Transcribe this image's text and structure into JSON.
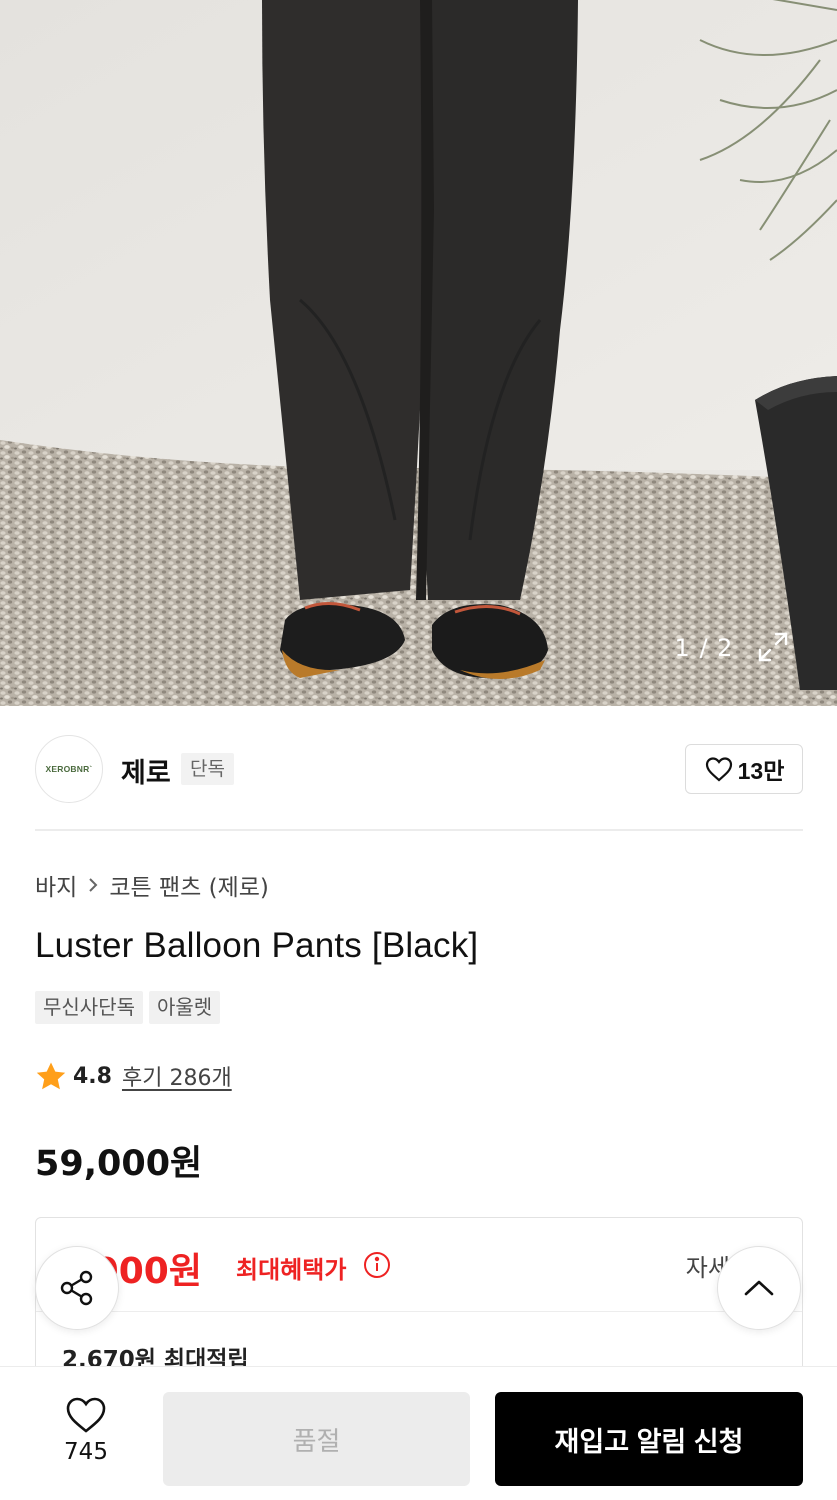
{
  "gallery": {
    "counter": "1 / 2",
    "expand_icon": "expand-icon"
  },
  "brand": {
    "logo_text": "XEROBNR`",
    "name": "제로",
    "badge": "단독",
    "like_count": "13만"
  },
  "breadcrumb": {
    "category": "바지",
    "subcategory": "코튼 팬츠 (제로)"
  },
  "product": {
    "title": "Luster Balloon Pants [Black]",
    "tags": [
      "무신사단독",
      "아울렛"
    ],
    "rating": "4.8",
    "reviews": "후기 286개",
    "price": "59,000원"
  },
  "benefit": {
    "price_partial": ",000원",
    "label": "최대혜택가",
    "detail": "자세히",
    "points": "2,670원 최대적립"
  },
  "bottom_bar": {
    "wish_count": "745",
    "soldout_label": "품절",
    "restock_label": "재입고 알림 신청"
  },
  "colors": {
    "accent_red": "#E22222",
    "primary_black": "#000000",
    "disabled_gray": "#ECECEC"
  }
}
